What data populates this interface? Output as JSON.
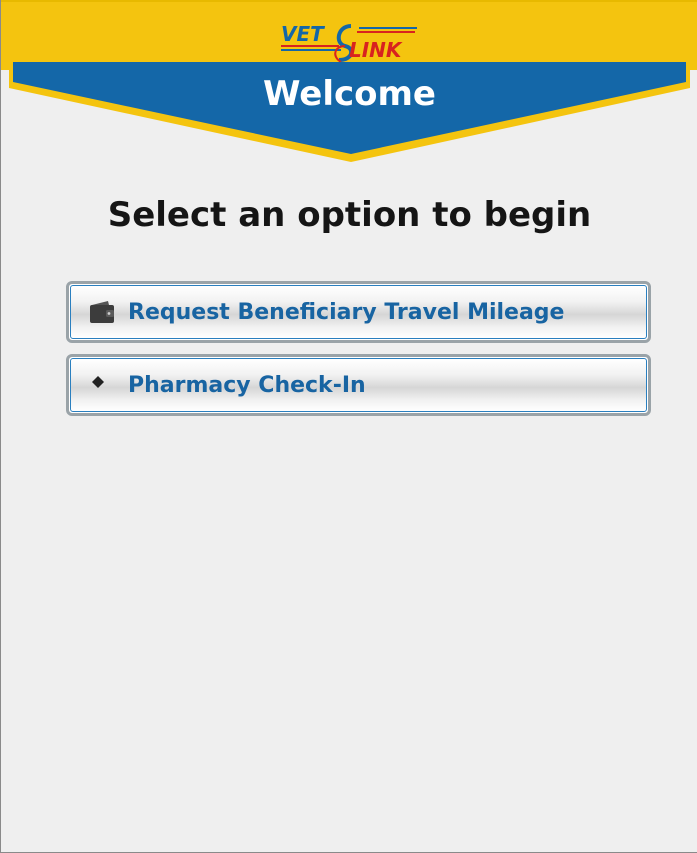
{
  "header": {
    "logo_text_left": "VET",
    "logo_text_right": "LINK",
    "banner_title": "Welcome"
  },
  "main": {
    "prompt": "Select an option to begin",
    "options": [
      {
        "label": "Request Beneficiary Travel Mileage",
        "icon": "wallet-icon"
      },
      {
        "label": "Pharmacy Check-In",
        "icon": "diamond-icon"
      }
    ]
  },
  "colors": {
    "header_yellow": "#f4c40f",
    "banner_blue": "#1467a8",
    "logo_red": "#d8231f",
    "option_text": "#1864a2",
    "background": "#efefef"
  }
}
